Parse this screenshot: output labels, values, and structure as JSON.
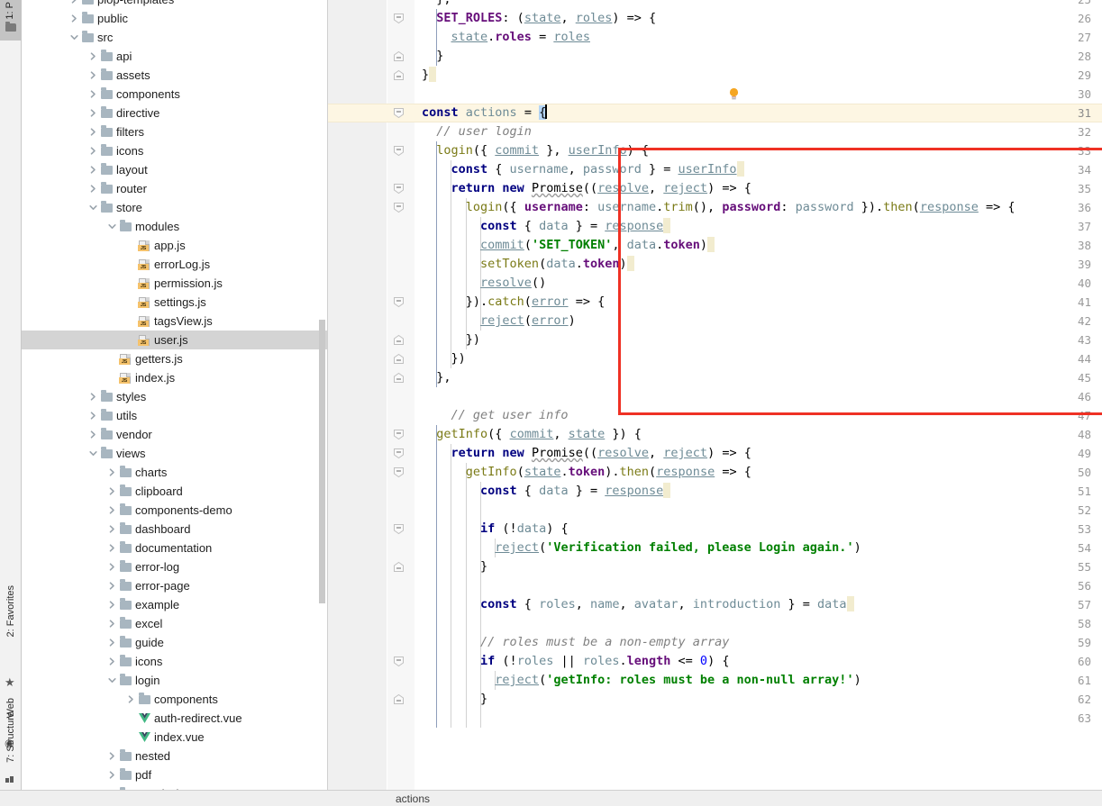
{
  "toolwindows": {
    "project_label": "1: P",
    "favorites_label": "2: Favorites",
    "web_label": "Web",
    "structure_label": "7: Structure"
  },
  "project_tree": {
    "rows": [
      {
        "indent": 1,
        "type": "folder",
        "twisty": "right",
        "label": "plop-templates",
        "partial": true
      },
      {
        "indent": 1,
        "type": "folder",
        "twisty": "right",
        "label": "public"
      },
      {
        "indent": 1,
        "type": "folder",
        "twisty": "down",
        "label": "src"
      },
      {
        "indent": 2,
        "type": "folder",
        "twisty": "right",
        "label": "api"
      },
      {
        "indent": 2,
        "type": "folder",
        "twisty": "right",
        "label": "assets"
      },
      {
        "indent": 2,
        "type": "folder",
        "twisty": "right",
        "label": "components"
      },
      {
        "indent": 2,
        "type": "folder",
        "twisty": "right",
        "label": "directive"
      },
      {
        "indent": 2,
        "type": "folder",
        "twisty": "right",
        "label": "filters"
      },
      {
        "indent": 2,
        "type": "folder",
        "twisty": "right",
        "label": "icons"
      },
      {
        "indent": 2,
        "type": "folder",
        "twisty": "right",
        "label": "layout"
      },
      {
        "indent": 2,
        "type": "folder",
        "twisty": "right",
        "label": "router"
      },
      {
        "indent": 2,
        "type": "folder",
        "twisty": "down",
        "label": "store"
      },
      {
        "indent": 3,
        "type": "folder",
        "twisty": "down",
        "label": "modules"
      },
      {
        "indent": 4,
        "type": "js",
        "twisty": "none",
        "label": "app.js"
      },
      {
        "indent": 4,
        "type": "js",
        "twisty": "none",
        "label": "errorLog.js"
      },
      {
        "indent": 4,
        "type": "js",
        "twisty": "none",
        "label": "permission.js"
      },
      {
        "indent": 4,
        "type": "js",
        "twisty": "none",
        "label": "settings.js"
      },
      {
        "indent": 4,
        "type": "js",
        "twisty": "none",
        "label": "tagsView.js"
      },
      {
        "indent": 4,
        "type": "js",
        "twisty": "none",
        "label": "user.js",
        "selected": true
      },
      {
        "indent": 3,
        "type": "js",
        "twisty": "none",
        "label": "getters.js"
      },
      {
        "indent": 3,
        "type": "js",
        "twisty": "none",
        "label": "index.js"
      },
      {
        "indent": 2,
        "type": "folder",
        "twisty": "right",
        "label": "styles"
      },
      {
        "indent": 2,
        "type": "folder",
        "twisty": "right",
        "label": "utils"
      },
      {
        "indent": 2,
        "type": "folder",
        "twisty": "right",
        "label": "vendor"
      },
      {
        "indent": 2,
        "type": "folder",
        "twisty": "down",
        "label": "views"
      },
      {
        "indent": 3,
        "type": "folder",
        "twisty": "right",
        "label": "charts"
      },
      {
        "indent": 3,
        "type": "folder",
        "twisty": "right",
        "label": "clipboard"
      },
      {
        "indent": 3,
        "type": "folder",
        "twisty": "right",
        "label": "components-demo"
      },
      {
        "indent": 3,
        "type": "folder",
        "twisty": "right",
        "label": "dashboard"
      },
      {
        "indent": 3,
        "type": "folder",
        "twisty": "right",
        "label": "documentation"
      },
      {
        "indent": 3,
        "type": "folder",
        "twisty": "right",
        "label": "error-log"
      },
      {
        "indent": 3,
        "type": "folder",
        "twisty": "right",
        "label": "error-page"
      },
      {
        "indent": 3,
        "type": "folder",
        "twisty": "right",
        "label": "example"
      },
      {
        "indent": 3,
        "type": "folder",
        "twisty": "right",
        "label": "excel"
      },
      {
        "indent": 3,
        "type": "folder",
        "twisty": "right",
        "label": "guide"
      },
      {
        "indent": 3,
        "type": "folder",
        "twisty": "right",
        "label": "icons"
      },
      {
        "indent": 3,
        "type": "folder",
        "twisty": "down",
        "label": "login"
      },
      {
        "indent": 4,
        "type": "folder",
        "twisty": "right",
        "label": "components"
      },
      {
        "indent": 4,
        "type": "vue",
        "twisty": "none",
        "label": "auth-redirect.vue"
      },
      {
        "indent": 4,
        "type": "vue",
        "twisty": "none",
        "label": "index.vue"
      },
      {
        "indent": 3,
        "type": "folder",
        "twisty": "right",
        "label": "nested"
      },
      {
        "indent": 3,
        "type": "folder",
        "twisty": "right",
        "label": "pdf"
      },
      {
        "indent": 3,
        "type": "folder",
        "twisty": "right",
        "label": "permission"
      }
    ]
  },
  "editor": {
    "first_visible_line": 25,
    "current_line": 31,
    "line_height": 21,
    "annotation_color": "#ef3124",
    "lines": [
      {
        "n": 25,
        "fold": "none"
      },
      {
        "n": 26,
        "fold": "open"
      },
      {
        "n": 27,
        "fold": "none"
      },
      {
        "n": 28,
        "fold": "close"
      },
      {
        "n": 29,
        "fold": "close"
      },
      {
        "n": 30,
        "fold": "none",
        "bulb": true
      },
      {
        "n": 31,
        "fold": "open",
        "highlight": true
      },
      {
        "n": 32,
        "fold": "none"
      },
      {
        "n": 33,
        "fold": "open"
      },
      {
        "n": 34,
        "fold": "none"
      },
      {
        "n": 35,
        "fold": "open"
      },
      {
        "n": 36,
        "fold": "open"
      },
      {
        "n": 37,
        "fold": "none"
      },
      {
        "n": 38,
        "fold": "none"
      },
      {
        "n": 39,
        "fold": "none"
      },
      {
        "n": 40,
        "fold": "none"
      },
      {
        "n": 41,
        "fold": "open"
      },
      {
        "n": 42,
        "fold": "none"
      },
      {
        "n": 43,
        "fold": "close"
      },
      {
        "n": 44,
        "fold": "close"
      },
      {
        "n": 45,
        "fold": "close"
      },
      {
        "n": 46,
        "fold": "none"
      },
      {
        "n": 47,
        "fold": "none"
      },
      {
        "n": 48,
        "fold": "open"
      },
      {
        "n": 49,
        "fold": "open"
      },
      {
        "n": 50,
        "fold": "open"
      },
      {
        "n": 51,
        "fold": "none"
      },
      {
        "n": 52,
        "fold": "none"
      },
      {
        "n": 53,
        "fold": "open"
      },
      {
        "n": 54,
        "fold": "none"
      },
      {
        "n": 55,
        "fold": "close"
      },
      {
        "n": 56,
        "fold": "none"
      },
      {
        "n": 57,
        "fold": "none"
      },
      {
        "n": 58,
        "fold": "none"
      },
      {
        "n": 59,
        "fold": "none"
      },
      {
        "n": 60,
        "fold": "open"
      },
      {
        "n": 61,
        "fold": "none"
      },
      {
        "n": 62,
        "fold": "close"
      },
      {
        "n": 63,
        "fold": "none"
      }
    ],
    "source_text": [
      "  },",
      "  SET_ROLES: (state, roles) => {",
      "    state.roles = roles",
      "  }",
      "}",
      "",
      "const actions = {",
      "  // user login",
      "  login({ commit }, userInfo) {",
      "    const { username, password } = userInfo",
      "    return new Promise((resolve, reject) => {",
      "      login({ username: username.trim(), password: password }).then(response => {",
      "        const { data } = response",
      "        commit('SET_TOKEN', data.token)",
      "        setToken(data.token)",
      "        resolve()",
      "      }).catch(error => {",
      "        reject(error)",
      "      })",
      "    })",
      "  },",
      "",
      "  // get user info",
      "  getInfo({ commit, state }) {",
      "    return new Promise((resolve, reject) => {",
      "      getInfo(state.token).then(response => {",
      "        const { data } = response",
      "",
      "        if (!data) {",
      "          reject('Verification failed, please Login again.')",
      "        }",
      "",
      "        const { roles, name, avatar, introduction } = data",
      "",
      "        // roles must be a non-empty array",
      "        if (!roles || roles.length <= 0) {",
      "          reject('getInfo: roles must be a non-null array!')",
      "        }",
      ""
    ]
  },
  "annotation": {
    "label": "red-highlight-box",
    "color": "#ef3124",
    "covers_lines": "33-45"
  },
  "statusbar": {
    "breadcrumb": "actions"
  }
}
